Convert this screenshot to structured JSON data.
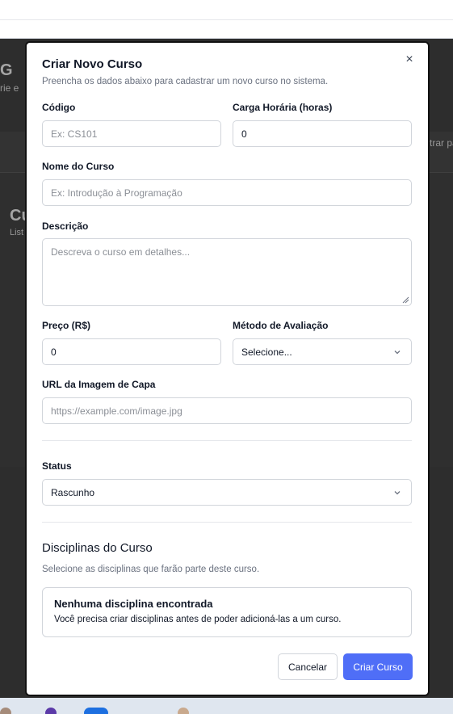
{
  "background": {
    "heading_fragment": "G",
    "sub_fragment": "rie e",
    "right_fragment": "trar pa",
    "title_fragment": "Cu",
    "list_fragment": "List"
  },
  "modal": {
    "title": "Criar Novo Curso",
    "subtitle": "Preencha os dados abaixo para cadastrar um novo curso no sistema.",
    "close_icon": "×",
    "fields": {
      "codigo": {
        "label": "Código",
        "placeholder": "Ex: CS101"
      },
      "carga_horaria": {
        "label": "Carga Horária (horas)",
        "value": "0"
      },
      "nome": {
        "label": "Nome do Curso",
        "placeholder": "Ex: Introdução à Programação"
      },
      "descricao": {
        "label": "Descrição",
        "placeholder": "Descreva o curso em detalhes..."
      },
      "preco": {
        "label": "Preço (R$)",
        "value": "0"
      },
      "metodo_avaliacao": {
        "label": "Método de Avaliação",
        "value": "Selecione..."
      },
      "url_imagem": {
        "label": "URL da Imagem de Capa",
        "placeholder": "https://example.com/image.jpg"
      },
      "status": {
        "label": "Status",
        "value": "Rascunho"
      }
    },
    "disciplinas": {
      "title": "Disciplinas do Curso",
      "subtitle": "Selecione as disciplinas que farão parte deste curso.",
      "empty_title": "Nenhuma disciplina encontrada",
      "empty_desc": "Você precisa criar disciplinas antes de poder adicioná-las a um curso."
    },
    "buttons": {
      "cancel": "Cancelar",
      "create": "Criar Curso"
    }
  },
  "colors": {
    "primary": "#4f6ef7",
    "border": "#d1d5db",
    "muted_text": "#6b7280"
  }
}
